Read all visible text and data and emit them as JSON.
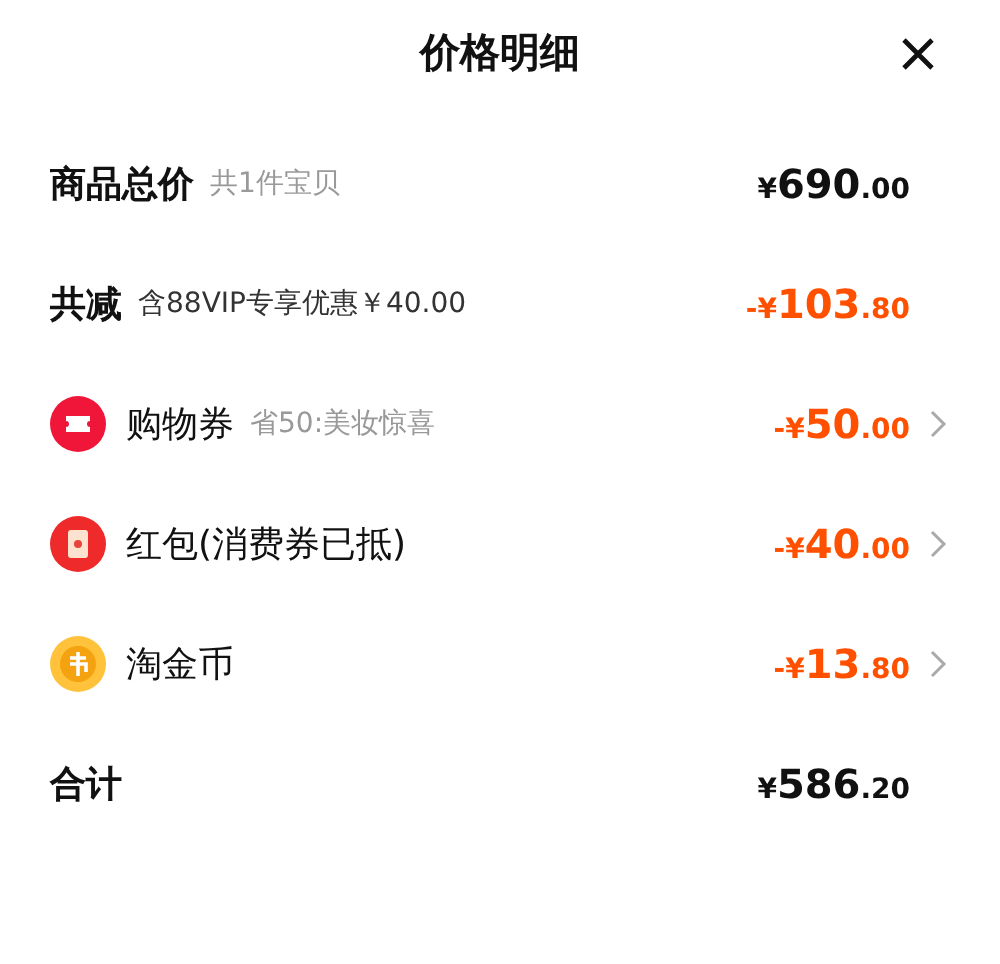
{
  "title": "价格明细",
  "rows": [
    {
      "kind": "summary",
      "label": "商品总价",
      "note": "共1件宝贝",
      "amount": {
        "currency": "¥",
        "integer": "690",
        "decimal": ".00"
      },
      "discount": false
    },
    {
      "kind": "summary",
      "label": "共减",
      "note": "含88VIP专享优惠￥40.00",
      "amount": {
        "sign": "-",
        "currency": "¥",
        "integer": "103",
        "decimal": ".80"
      },
      "discount": true
    },
    {
      "kind": "ticket",
      "label": "购物券",
      "note": "省50:美妆惊喜",
      "amount": {
        "sign": "-",
        "currency": "¥",
        "integer": "50",
        "decimal": ".00"
      },
      "discount": true
    },
    {
      "kind": "envelope",
      "label": "红包(消费券已抵)",
      "amount": {
        "sign": "-",
        "currency": "¥",
        "integer": "40",
        "decimal": ".00"
      },
      "discount": true
    },
    {
      "kind": "coin",
      "label": "淘金币",
      "amount": {
        "sign": "-",
        "currency": "¥",
        "integer": "13",
        "decimal": ".80"
      },
      "discount": true
    },
    {
      "kind": "summary",
      "label": "合计",
      "amount": {
        "currency": "¥",
        "integer": "586",
        "decimal": ".20"
      },
      "discount": false
    }
  ]
}
